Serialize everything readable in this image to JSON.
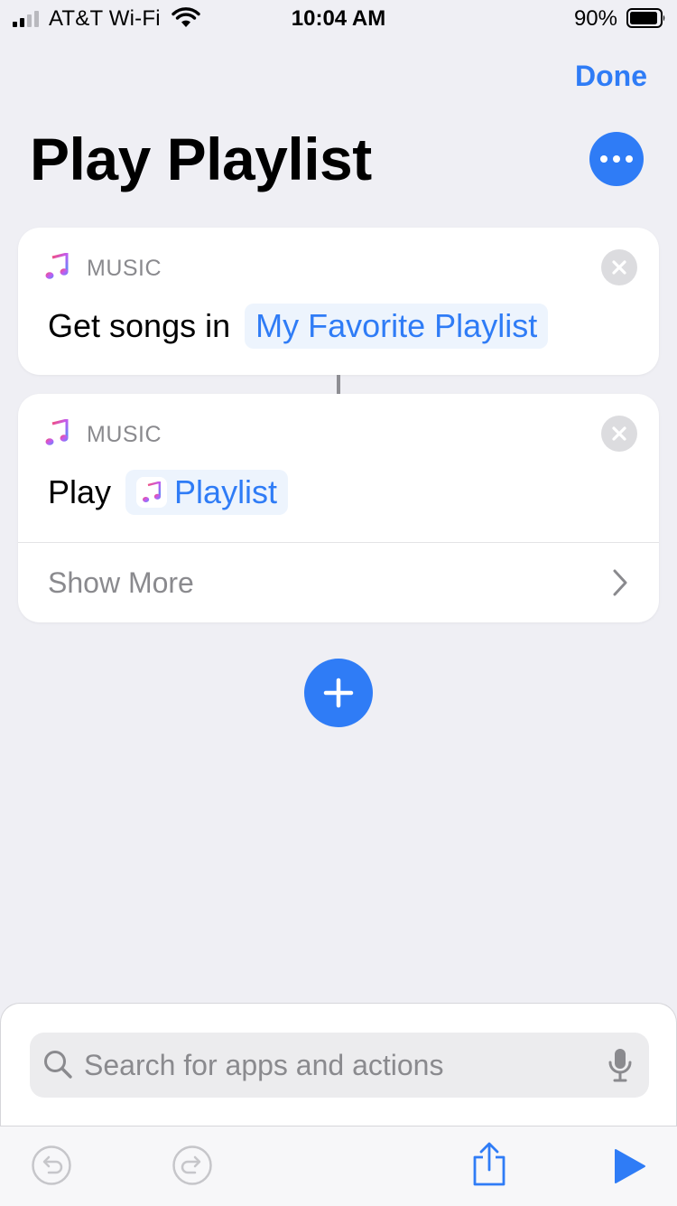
{
  "status_bar": {
    "carrier": "AT&T Wi-Fi",
    "time": "10:04 AM",
    "battery_percent": "90%"
  },
  "header": {
    "done_label": "Done",
    "title": "Play Playlist"
  },
  "actions": [
    {
      "app": "MUSIC",
      "verb": "Get songs in",
      "parameter": "My Favorite Playlist"
    },
    {
      "app": "MUSIC",
      "verb": "Play",
      "parameter": "Playlist",
      "show_more_label": "Show More"
    }
  ],
  "search": {
    "placeholder": "Search for apps and actions",
    "value": ""
  },
  "colors": {
    "accent": "#2f7cf6",
    "background": "#efeff4"
  },
  "icons": {
    "music": "music-note-icon",
    "remove": "close-icon",
    "more": "ellipsis-icon",
    "add": "plus-icon",
    "undo": "undo-icon",
    "redo": "redo-icon",
    "share": "share-icon",
    "run": "play-icon"
  }
}
